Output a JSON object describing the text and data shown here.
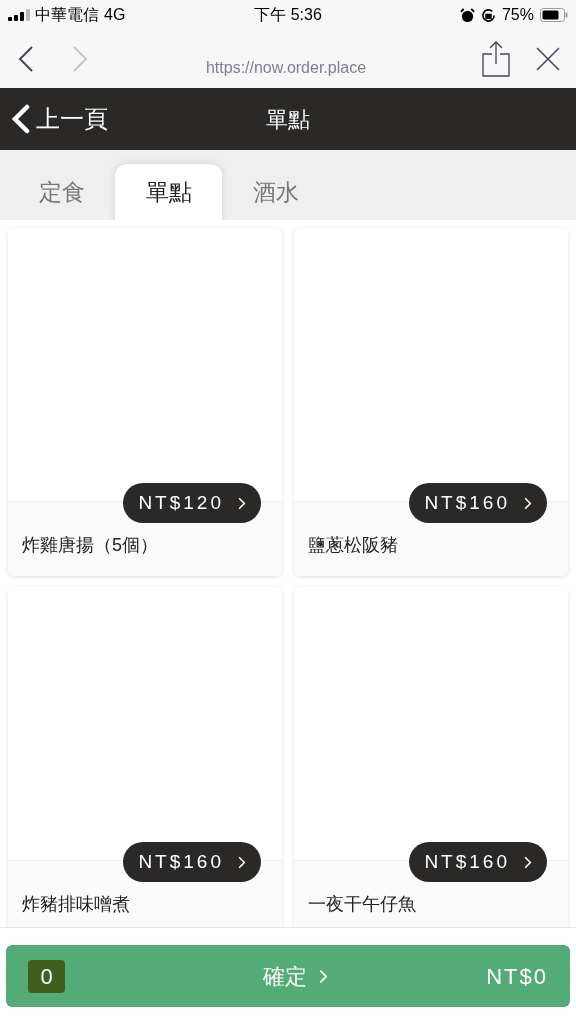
{
  "status_bar": {
    "carrier": "中華電信",
    "network": "4G",
    "time": "下午 5:36",
    "battery": "75%"
  },
  "browser": {
    "url": "https://now.order.place"
  },
  "header": {
    "back": "上一頁",
    "title": "單點"
  },
  "tabs": [
    {
      "label": "定食",
      "selected": false
    },
    {
      "label": "單點",
      "selected": true
    },
    {
      "label": "酒水",
      "selected": false
    }
  ],
  "items": [
    {
      "name": "炸雞唐揚（5個）",
      "price": "NT$120"
    },
    {
      "name": "鹽蔥松阪豬",
      "price": "NT$160"
    },
    {
      "name": "炸豬排味噌煮",
      "price": "NT$160"
    },
    {
      "name": "一夜干午仔魚",
      "price": "NT$160"
    }
  ],
  "footer": {
    "count": "0",
    "confirm": "確定",
    "total": "NT$0"
  }
}
